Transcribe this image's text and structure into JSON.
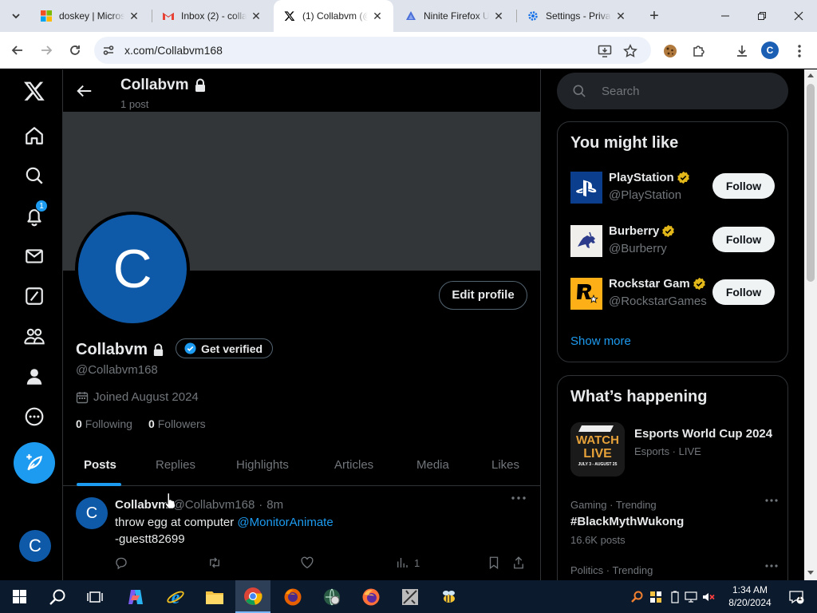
{
  "browser": {
    "tabs": [
      {
        "title": "doskey | Micros",
        "icon": "microsoft-icon"
      },
      {
        "title": "Inbox (2) - colla",
        "icon": "gmail-icon"
      },
      {
        "title": "(1) Collabvm (@",
        "icon": "x-icon",
        "active": true
      },
      {
        "title": "Ninite Firefox U",
        "icon": "ninite-icon"
      },
      {
        "title": "Settings - Priva",
        "icon": "gear-icon"
      }
    ],
    "url": "x.com/Collabvm168",
    "profile_initial": "C"
  },
  "nav": {
    "notification_count": "1",
    "avatar_initial": "C"
  },
  "header": {
    "name": "Collabvm",
    "post_count": "1 post"
  },
  "profile": {
    "avatar_initial": "C",
    "edit_label": "Edit profile",
    "name": "Collabvm",
    "verify_label": "Get verified",
    "handle": "@Collabvm168",
    "joined": "Joined August 2024",
    "following_count": "0",
    "following_label": "Following",
    "followers_count": "0",
    "followers_label": "Followers"
  },
  "tabs": [
    "Posts",
    "Replies",
    "Highlights",
    "Articles",
    "Media",
    "Likes"
  ],
  "tweet": {
    "avatar_initial": "C",
    "name": "Collabvm",
    "handle": "@Collabvm168",
    "sep": "·",
    "time": "8m",
    "text_before": "throw egg at computer ",
    "mention": "@MonitorAnimate",
    "text_line2": "-guestt82699",
    "views": "1"
  },
  "search": {
    "placeholder": "Search"
  },
  "who_to_follow": {
    "title": "You might like",
    "accounts": [
      {
        "name": "PlayStation",
        "handle": "@PlayStation",
        "button": "Follow",
        "verified_color": "#e2b719"
      },
      {
        "name": "Burberry",
        "handle": "@Burberry",
        "button": "Follow",
        "verified_color": "#e2b719"
      },
      {
        "name": "Rockstar Gam",
        "handle": "@RockstarGames",
        "button": "Follow",
        "verified_color": "#e2b719"
      }
    ],
    "show_more": "Show more"
  },
  "happening": {
    "title": "What’s happening",
    "event": {
      "name": "Esports World Cup 2024",
      "sub": "Esports · LIVE",
      "thumb_top": "WATCH",
      "thumb_mid": "LIVE",
      "thumb_bottom": "JULY 3 - AUGUST 25"
    },
    "trends": [
      {
        "meta": "Gaming · Trending",
        "name": "#BlackMythWukong",
        "count": "16.6K posts"
      },
      {
        "meta": "Politics · Trending",
        "name": "",
        "count": ""
      }
    ]
  },
  "taskbar": {
    "time": "1:34 AM",
    "date": "8/20/2024",
    "notifications": "1"
  },
  "colors": {
    "accent": "#1d9bf0",
    "avatar": "#0f5aa8",
    "background": "#000000"
  }
}
